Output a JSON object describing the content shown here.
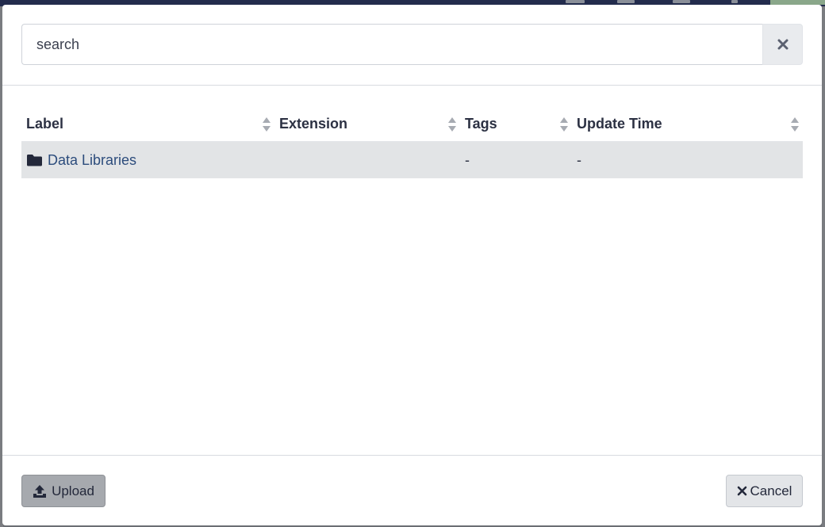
{
  "search": {
    "placeholder": "search",
    "value": ""
  },
  "table": {
    "columns": [
      {
        "label": "Label"
      },
      {
        "label": "Extension"
      },
      {
        "label": "Tags"
      },
      {
        "label": "Update Time"
      }
    ],
    "rows": [
      {
        "label": "Data Libraries",
        "extension": "",
        "tags": "-",
        "update_time": "-"
      }
    ]
  },
  "footer": {
    "upload_label": "Upload",
    "cancel_label": "Cancel"
  },
  "colors": {
    "link": "#2c4c7c",
    "row_bg": "#e2e4e6",
    "header_bar": "#232c4d"
  },
  "icons": {
    "clear": "times-icon",
    "folder": "folder-icon",
    "sort": "sort-icon",
    "upload": "upload-icon",
    "cancel": "times-icon"
  }
}
